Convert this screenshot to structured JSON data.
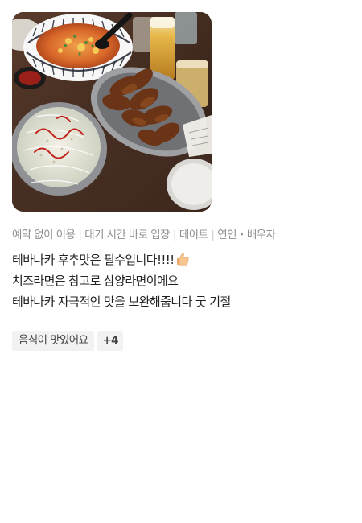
{
  "photo": {
    "alt_subject": "food-photo"
  },
  "meta_tags": [
    "예약 없이 이용",
    "대기 시간 바로 입장",
    "데이트",
    "연인・배우자"
  ],
  "review_lines": [
    "테바나카 후추맛은 필수입니다!!!!",
    "치즈라면은 참고로 삼양라면이에요",
    "테바나카 자극적인 맛을 보완해줍니다 굿 기절"
  ],
  "emoji": "thumbs-up-icon",
  "keywords": {
    "first": "음식이 맛있어요",
    "more": "+4"
  }
}
